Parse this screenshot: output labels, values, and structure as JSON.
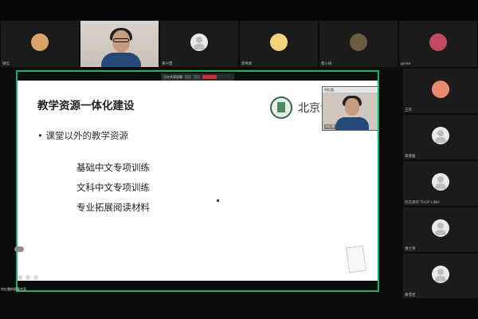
{
  "gallery": [
    {
      "name": "微信",
      "avatar": "cat-icon",
      "type": "avatar",
      "style": "sticker"
    },
    {
      "name": "刘红霞",
      "avatar": "person",
      "type": "video"
    },
    {
      "name": "黄兴慧",
      "avatar": "user-icon",
      "type": "avatar",
      "style": "gray"
    },
    {
      "name": "郭秀新",
      "avatar": "cat-icon",
      "type": "avatar",
      "style": "cat"
    },
    {
      "name": "蔡小研",
      "avatar": "bird-icon",
      "type": "avatar",
      "style": "bird"
    },
    {
      "name": "gerke",
      "avatar": "badge-icon",
      "type": "avatar",
      "style": "badge"
    }
  ],
  "share": {
    "toolbar_label": "正在共享屏幕",
    "stop_label": "停止共享",
    "presenter_name": "刘红霞",
    "shared_name": "刘红霞的屏幕共享"
  },
  "slide": {
    "title": "教学资源一体化建设",
    "bullet": "• 课堂以外的教学资源",
    "items": [
      "基础中文专项训练",
      "文科中文专项训练",
      "专业拓展阅读材料"
    ],
    "logo_text": "北京语"
  },
  "right_column": [
    {
      "name": "王玲",
      "avatar": "flower-icon",
      "style": "flower"
    },
    {
      "name": "黄香媛",
      "avatar": "user-icon",
      "style": "gray"
    },
    {
      "name": "阮氏清玲 THUY LINH",
      "avatar": "user-icon",
      "style": "gray"
    },
    {
      "name": "潘兰英",
      "avatar": "user-icon",
      "style": "gray"
    },
    {
      "name": "黄雪岩",
      "avatar": "user-icon",
      "style": "gray"
    }
  ],
  "colors": {
    "accent": "#15b26a",
    "background": "#0b0b0b",
    "slide": "#ffffff"
  }
}
